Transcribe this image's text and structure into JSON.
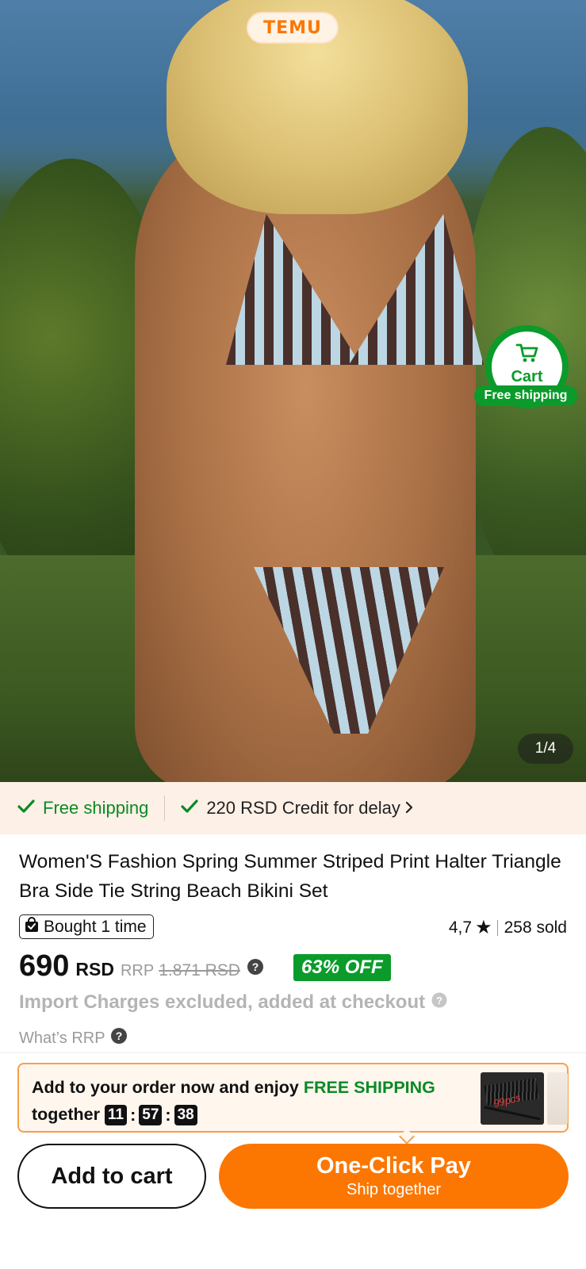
{
  "brand": {
    "logo_text": "TEMU",
    "accent_color": "#fb7701",
    "green_color": "#0a9b2a"
  },
  "gallery": {
    "counter": "1/4"
  },
  "floating_cart": {
    "label": "Cart",
    "badge": "Free shipping",
    "icon": "cart-icon"
  },
  "shipping_bar": {
    "free_shipping": "Free shipping",
    "credit": "220 RSD Credit for delay",
    "check_icon": "check-icon",
    "chevron_icon": "chevron-right-icon"
  },
  "product": {
    "title": "Women'S Fashion Spring Summer Striped Print Halter Triangle Bra Side Tie String Beach Bikini Set",
    "bought_badge": "Bought 1 time",
    "rating": "4,7",
    "sold": "258 sold",
    "price": "690",
    "currency": "RSD",
    "rrp_label": "RRP",
    "rrp_value": "1.871 RSD",
    "discount": "63% OFF",
    "import_note": "Import Charges excluded, added at checkout",
    "whats_rrp": "What’s RRP"
  },
  "promo": {
    "text_before": "Add to your order now and enjoy ",
    "text_highlight": "FREE SHIPPING",
    "text_after": "together",
    "timer": {
      "hours": "11",
      "minutes": "57",
      "seconds": "38"
    },
    "thumb_label": "99pcs"
  },
  "actions": {
    "add_to_cart": "Add to cart",
    "one_click": "One-Click Pay",
    "one_click_sub": "Ship together"
  }
}
